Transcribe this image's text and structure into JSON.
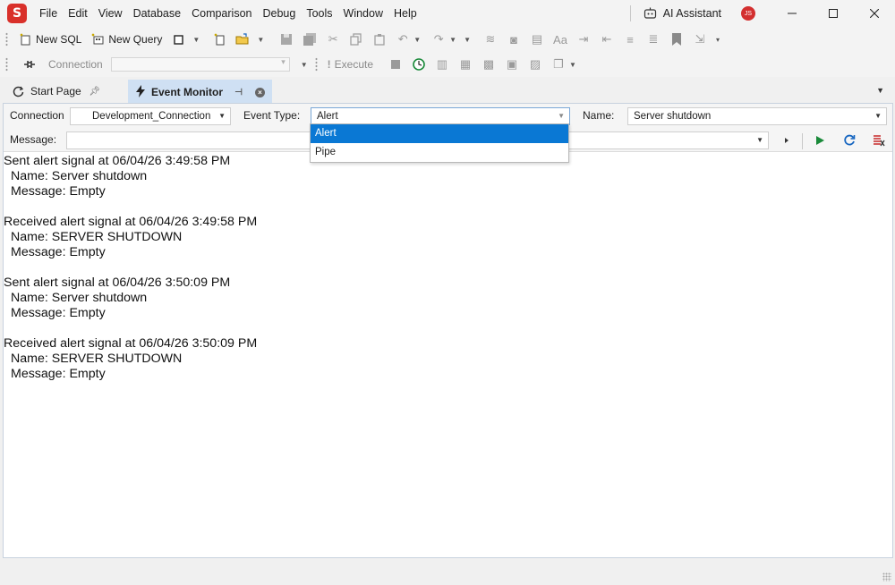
{
  "app": {
    "logo_letter": "S",
    "menu": [
      "File",
      "Edit",
      "View",
      "Database",
      "Comparison",
      "Debug",
      "Tools",
      "Window",
      "Help"
    ],
    "ai_assistant_label": "AI Assistant",
    "user_initials": "JS",
    "user_badge_color": "#d32f2f"
  },
  "toolbar1": {
    "new_sql": "New SQL",
    "new_query": "New Query"
  },
  "toolbar2": {
    "connection_label": "Connection",
    "execute_label": "Execute"
  },
  "tabs": [
    {
      "label": "Start Page",
      "icon": "start-page-icon",
      "active": false
    },
    {
      "label": "Event Monitor",
      "icon": "lightning-icon",
      "active": true
    }
  ],
  "monitor": {
    "connection_label": "Connection",
    "connection_value": "Development_Connection",
    "event_type_label": "Event Type:",
    "event_type_value": "Alert",
    "event_type_options": [
      "Alert",
      "Pipe"
    ],
    "event_type_selected_index": 0,
    "name_label": "Name:",
    "name_value": "Server shutdown",
    "message_label": "Message:",
    "message_value": ""
  },
  "log": [
    {
      "header": "Sent alert signal at 06/04/26 3:49:58 PM",
      "name": "Name: Server shutdown",
      "message": "Message: Empty"
    },
    {
      "header": "Received alert signal at 06/04/26 3:49:58 PM",
      "name": "Name: SERVER SHUTDOWN",
      "message": "Message: Empty"
    },
    {
      "header": "Sent alert signal at 06/04/26 3:50:09 PM",
      "name": "Name: Server shutdown",
      "message": "Message: Empty"
    },
    {
      "header": "Received alert signal at 06/04/26 3:50:09 PM",
      "name": "Name: SERVER SHUTDOWN",
      "message": "Message: Empty"
    }
  ],
  "colors": {
    "accent": "#0a78d4",
    "active_tab": "#cfe0f3",
    "logo": "#d9302a",
    "run_green": "#1a8a3a",
    "refresh_blue": "#1565c0",
    "clear_red": "#c62828"
  }
}
